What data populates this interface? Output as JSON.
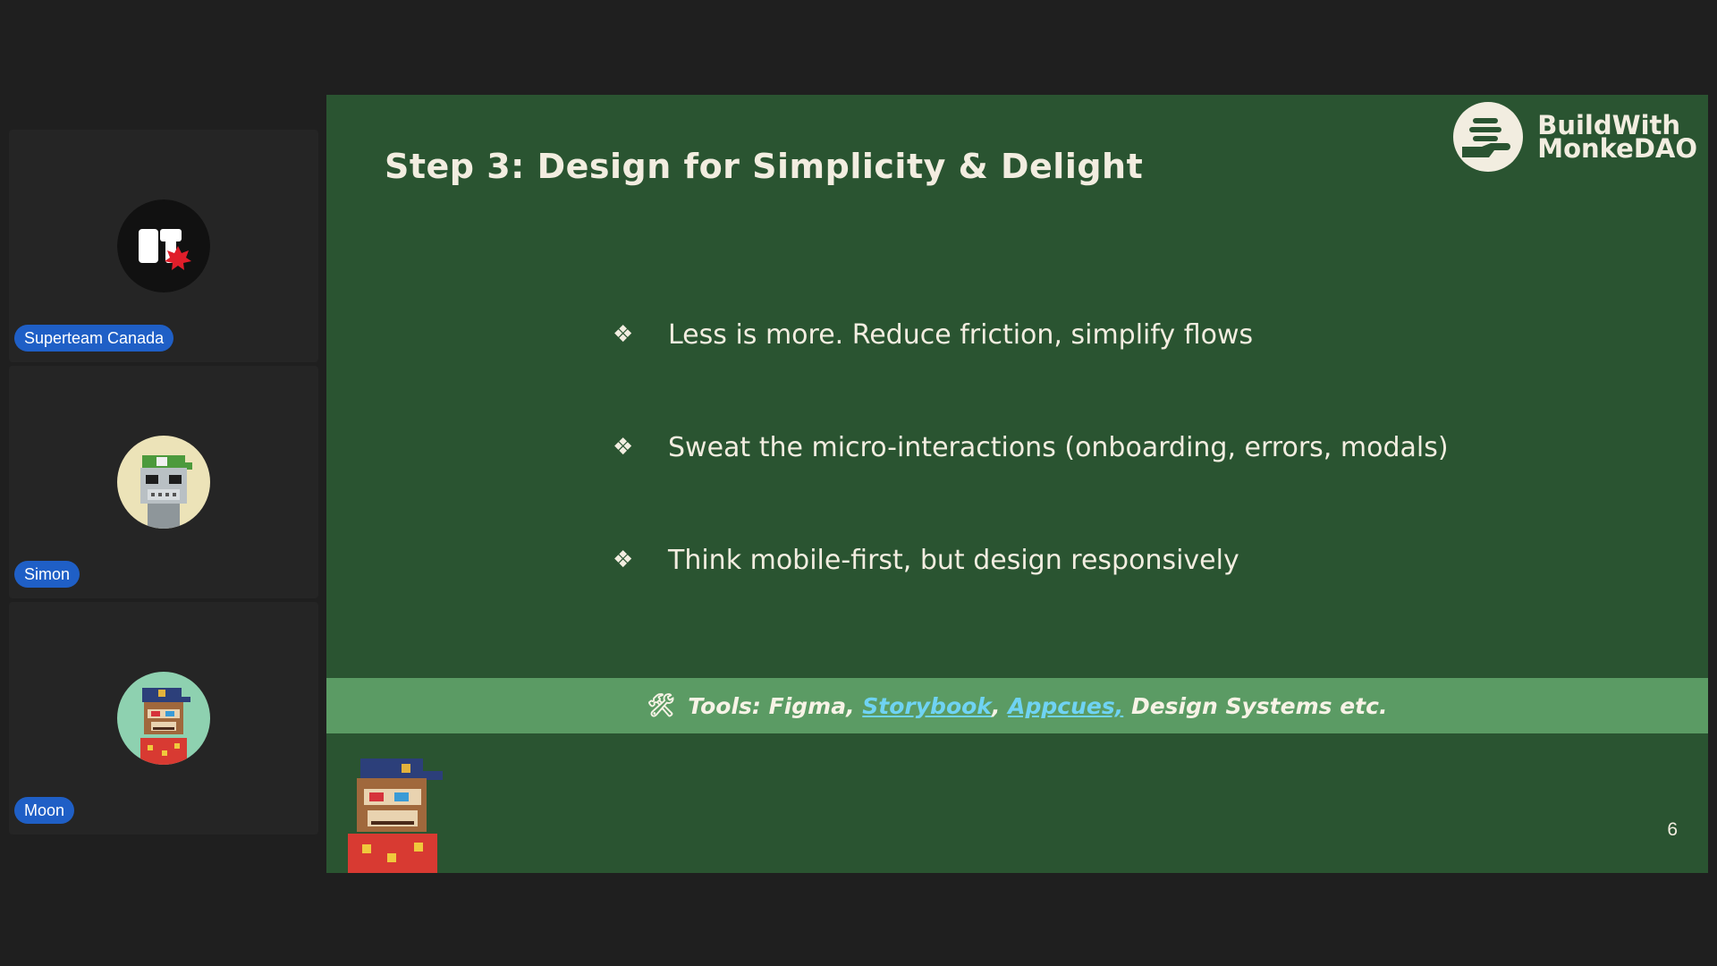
{
  "participants": [
    {
      "name": "Superteam Canada",
      "avatar_icon": "superteam-canada-logo-icon"
    },
    {
      "name": "Simon",
      "avatar_icon": "pixel-monkey-robot-avatar-icon"
    },
    {
      "name": "Moon",
      "avatar_icon": "pixel-monkey-cap-avatar-icon"
    }
  ],
  "slide": {
    "title": "Step 3: Design for Simplicity & Delight",
    "brand": {
      "line1": "BuildWith",
      "line2": "MonkeDAO",
      "icon": "monkedao-hand-logo-icon"
    },
    "bullet_glyph": "❖",
    "bullets": [
      "Less is more. Reduce friction, simplify flows",
      "Sweat the micro-interactions (onboarding, errors, modals)",
      "Think mobile-first, but design responsively"
    ],
    "tools": {
      "icon": "🛠",
      "prefix": "Tools: Figma, ",
      "link1": "Storybook",
      "sep": ", ",
      "link2": "Appcues,",
      "suffix": " Design Systems etc."
    },
    "page_number": "6"
  },
  "colors": {
    "slide_bg": "#2a5431",
    "tools_bar_bg": "#5b9b64",
    "link": "#6fd3f3",
    "name_pill": "#1f5fc6"
  }
}
